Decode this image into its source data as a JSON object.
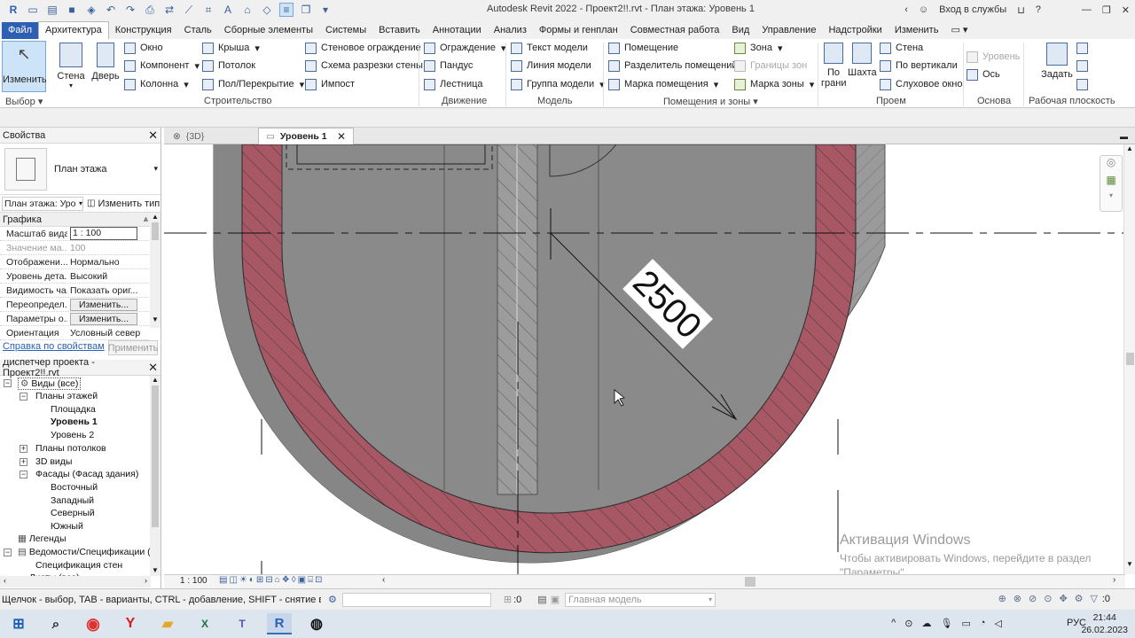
{
  "title_bar": {
    "title": "Autodesk Revit 2022 - Проект2!!.rvt - План этажа: Уровень 1",
    "login": "Вход в службы",
    "help": "?"
  },
  "menu": {
    "file": "Файл",
    "tabs": [
      "Архитектура",
      "Конструкция",
      "Сталь",
      "Сборные элементы",
      "Системы",
      "Вставить",
      "Аннотации",
      "Анализ",
      "Формы и генплан",
      "Совместная работа",
      "Вид",
      "Управление",
      "Надстройки",
      "Изменить"
    ],
    "active_index": 0
  },
  "ribbon": {
    "modify": "Изменить",
    "wall": "Стена",
    "door": "Дверь",
    "window": "Окно",
    "component": "Компонент",
    "column": "Колонна",
    "roof": "Крыша",
    "ceiling": "Потолок",
    "floor": "Пол/Перекрытие",
    "curtain_system": "Стеновое ограждение",
    "curtain_grid": "Схема разрезки стены",
    "mullion": "Импост",
    "railing": "Ограждение",
    "ramp": "Пандус",
    "stair": "Лестница",
    "model_text": "Текст модели",
    "model_line": "Линия  модели",
    "model_group": "Группа модели",
    "room": "Помещение",
    "room_separator": "Разделитель помещений",
    "room_tag": "Марка помещения",
    "area": "Зона",
    "area_boundary": "Границы  зон",
    "area_tag": "Марка  зоны",
    "by_face": "По\nграни",
    "shaft": "Шахта",
    "opening_wall": "Стена",
    "opening_vertical": "По вертикали",
    "dormer": "Слуховое окно",
    "level": "Уровень",
    "grid": "Ось",
    "set": "Задать",
    "groups": {
      "select": "Выбор",
      "build": "Строительство",
      "circulation": "Движение",
      "model": "Модель",
      "room_area": "Помещения и зоны",
      "opening": "Проем",
      "datum": "Основа",
      "work_plane": "Рабочая плоскость"
    }
  },
  "properties": {
    "header": "Свойства",
    "type_name": "План этажа",
    "selector_value": "План этажа: Уро",
    "edit_type": "Изменить тип",
    "section": "Графика",
    "rows": [
      {
        "key": "Масштаб вида",
        "value": "1 : 100"
      },
      {
        "key": "Значение ма...",
        "value": "100"
      },
      {
        "key": "Отображени...",
        "value": "Нормально"
      },
      {
        "key": "Уровень дета...",
        "value": "Высокий"
      },
      {
        "key": "Видимость ча...",
        "value": "Показать ориг..."
      },
      {
        "key": "Переопредел...",
        "value": "Изменить..."
      },
      {
        "key": "Параметры о...",
        "value": "Изменить..."
      },
      {
        "key": "Ориентация",
        "value": "Условный север"
      }
    ],
    "help_link": "Справка по свойствам",
    "apply": "Применить"
  },
  "browser": {
    "header": "Диспетчер проекта - Проект2!!.rvt",
    "views_all": "Виды (все)",
    "floor_plans": "Планы этажей",
    "site": "Площадка",
    "level1": "Уровень 1",
    "level2": "Уровень 2",
    "ceiling_plans": "Планы потолков",
    "views3d": "3D виды",
    "elevations": "Фасады (Фасад здания)",
    "east": "Восточный",
    "west": "Западный",
    "north": "Северный",
    "south": "Южный",
    "legends": "Легенды",
    "schedules": "Ведомости/Спецификации (",
    "wall_schedule": "Спецификация стен",
    "sheets": "Листы (все)"
  },
  "view_tabs": [
    {
      "label": "{3D}",
      "active": false
    },
    {
      "label": "Уровень 1",
      "active": true
    }
  ],
  "canvas": {
    "dimension": "2500",
    "activation_title": "Активация Windows",
    "activation_text": "Чтобы активировать Windows, перейдите в раздел\n\"Параметры\"."
  },
  "view_control": {
    "scale": "1 : 100"
  },
  "status": {
    "hint": "Щелчок - выбор, TAB - варианты, CTRL - добавление, SHIFT - снятие выбора.",
    "worksets": ":0",
    "model": "Главная модель",
    "filter_count": ":0"
  },
  "taskbar": {
    "time": "21:44",
    "date": "26.02.2023",
    "lang": "РУС"
  },
  "colors": {
    "wall_red": "#a85765",
    "floor_gray": "#868686",
    "file_tab": "#2d5fb4"
  }
}
